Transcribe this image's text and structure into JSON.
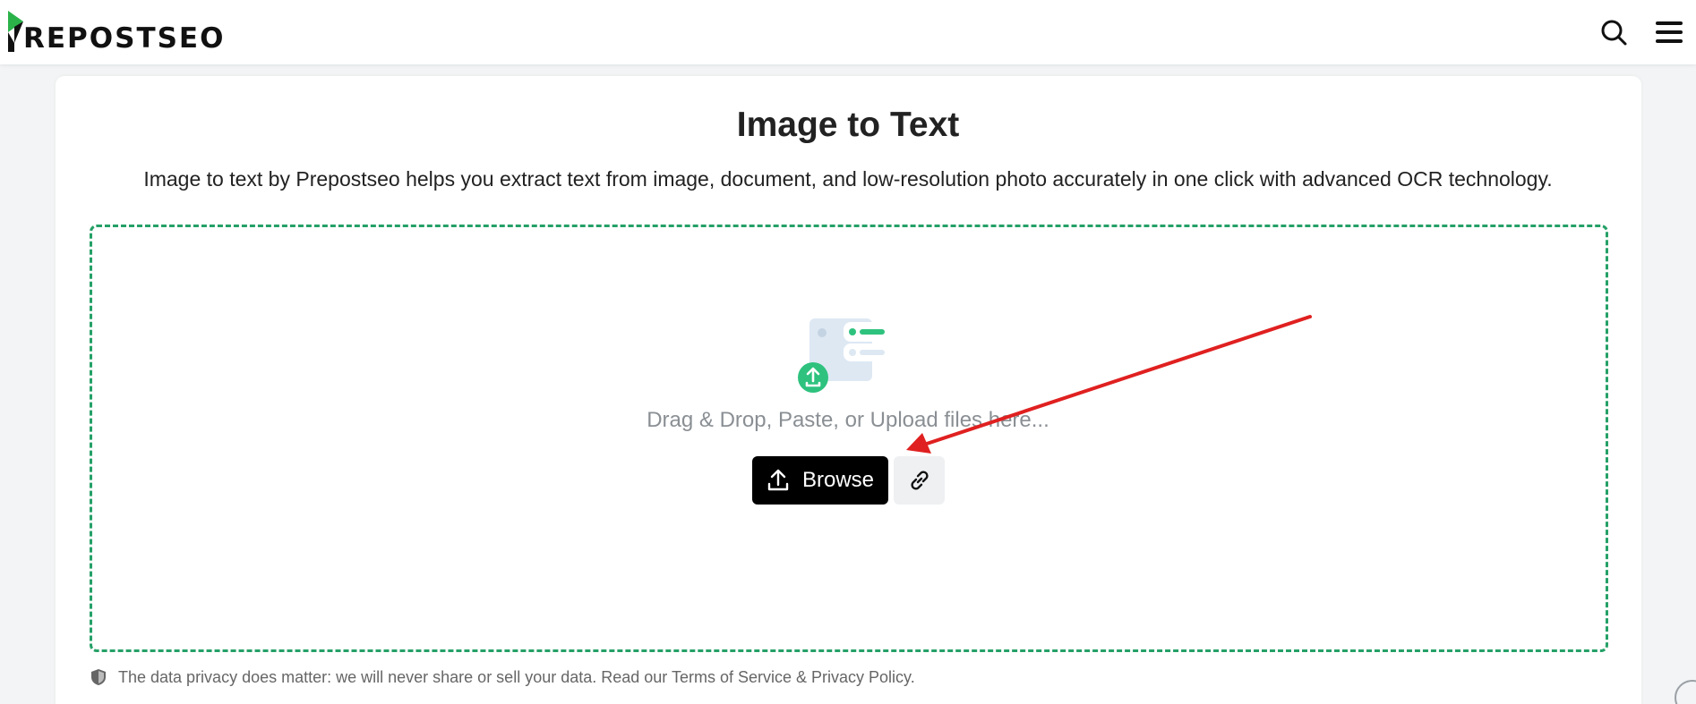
{
  "header": {
    "logo_text": "REPOSTSEO",
    "icons": [
      "search-icon",
      "hamburger-menu-icon"
    ]
  },
  "main": {
    "title": "Image to Text",
    "subtitle": "Image to text by Prepostseo helps you extract text from image, document, and low-resolution photo accurately in one click with advanced OCR technology.",
    "dropzone": {
      "hint": "Drag & Drop, Paste, or Upload files here...",
      "browse_label": "Browse",
      "upload_icon": "upload-icon",
      "url_icon": "link-icon"
    },
    "privacy_text": "The data privacy does matter: we will never share or sell your data. Read our Terms of Service & Privacy Policy."
  },
  "colors": {
    "brand_green": "#25a067",
    "accent_green": "#2ec27e",
    "annotation_red": "#e02020",
    "button_dark": "#000000"
  }
}
